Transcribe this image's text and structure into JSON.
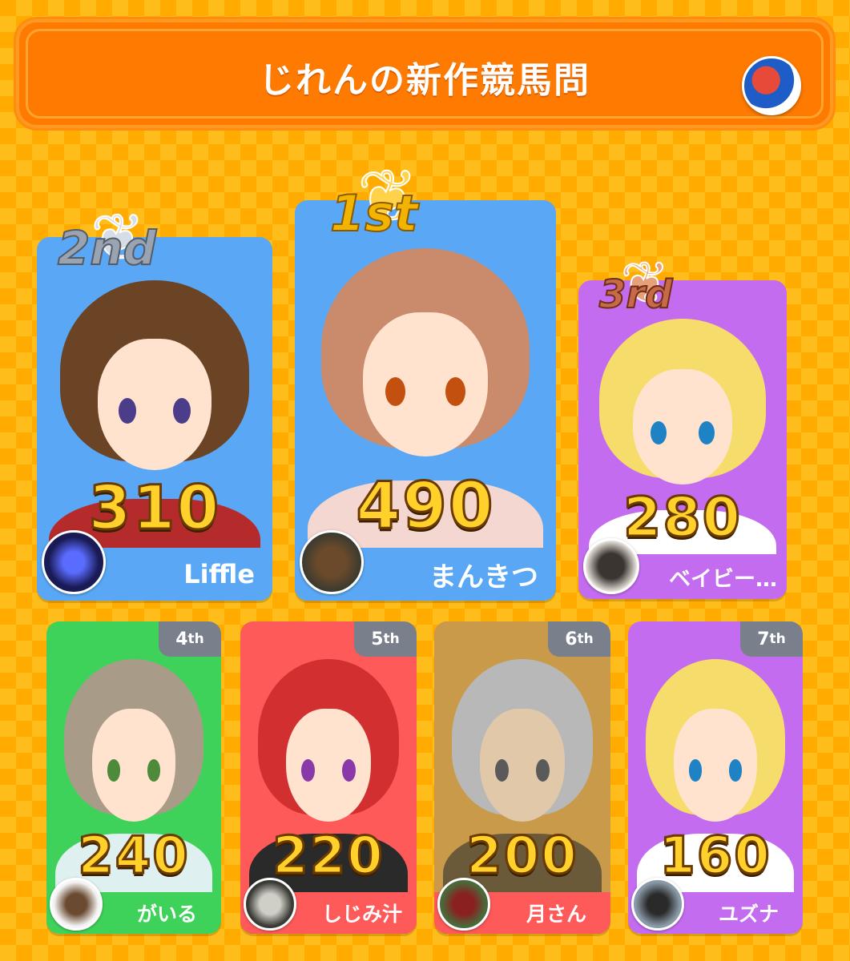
{
  "header": {
    "title": "じれんの新作競馬問",
    "host_avatar_icon": "host-avatar-icon"
  },
  "top3": [
    {
      "rank_label": "2nd",
      "score": "310",
      "player": "Liffle",
      "color": "#5aa8f5"
    },
    {
      "rank_label": "1st",
      "score": "490",
      "player": "まんきつ",
      "color": "#5aa8f5"
    },
    {
      "rank_label": "3rd",
      "score": "280",
      "player": "ベイビー…",
      "color": "#c46cf0"
    }
  ],
  "others": [
    {
      "rank_num": "4",
      "rank_suffix": "th",
      "score": "240",
      "player": "がいる",
      "color": "#3fd25a"
    },
    {
      "rank_num": "5",
      "rank_suffix": "th",
      "score": "220",
      "player": "しじみ汁",
      "color": "#ff5a5a"
    },
    {
      "rank_num": "6",
      "rank_suffix": "th",
      "score": "200",
      "player": "月さん",
      "color": "#ff5a5a"
    },
    {
      "rank_num": "7",
      "rank_suffix": "th",
      "score": "160",
      "player": "ユズナ",
      "color": "#c46cf0"
    }
  ]
}
